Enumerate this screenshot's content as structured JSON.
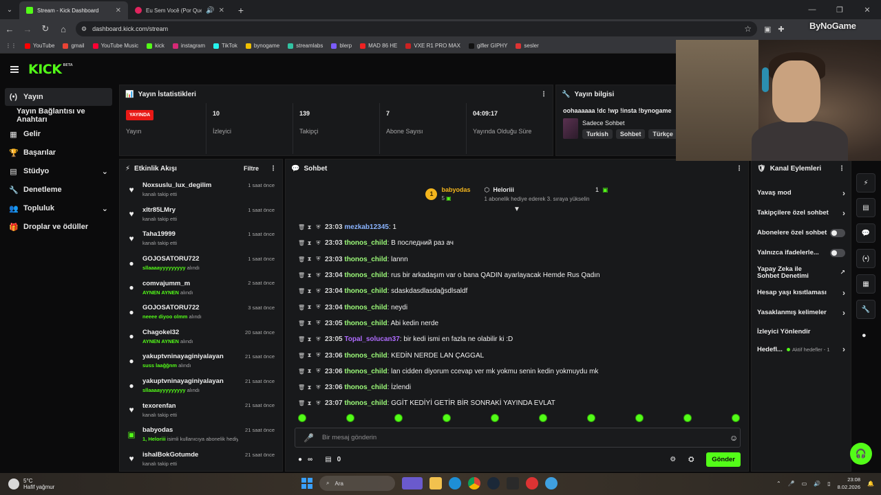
{
  "browser": {
    "tabs": [
      {
        "title": "Stream - Kick Dashboard",
        "favicon_color": "#53fc18",
        "active": true
      },
      {
        "title": "Eu Sem Você (Por Que Te V...",
        "favicon_color": "#e0245e",
        "active": false
      }
    ],
    "url": "dashboard.kick.com/stream",
    "bookmarks": [
      {
        "label": "YouTube",
        "color": "#ff0000"
      },
      {
        "label": "gmail",
        "color": "#ea4335"
      },
      {
        "label": "YouTube Music",
        "color": "#ff0033"
      },
      {
        "label": "kick",
        "color": "#53fc18"
      },
      {
        "label": "instagram",
        "color": "#d62976"
      },
      {
        "label": "TikTok",
        "color": "#25f4ee"
      },
      {
        "label": "bynogame",
        "color": "#f0c000"
      },
      {
        "label": "streamlabs",
        "color": "#31c3a2"
      },
      {
        "label": "blerp",
        "color": "#7b5cff"
      },
      {
        "label": "MAD 86 HE",
        "color": "#e22"
      },
      {
        "label": "VXE R1 PRO MAX",
        "color": "#c22"
      },
      {
        "label": "gifler GIPHY",
        "color": "#111"
      },
      {
        "label": "sesler",
        "color": "#d33"
      }
    ]
  },
  "watermark": "ByNoGame",
  "kick": {
    "logo": "KICK",
    "logo_badge": "BETA",
    "nav": [
      {
        "label": "Yayın",
        "icon": "broadcast-icon",
        "glyph": "(•)",
        "active": true
      },
      {
        "label": "Yayın Bağlantısı ve Anahtarı",
        "icon": "",
        "glyph": "",
        "sub": true
      },
      {
        "label": "Gelir",
        "icon": "revenue-icon",
        "glyph": "▦"
      },
      {
        "label": "Başarılar",
        "icon": "trophy-icon",
        "glyph": "🏆"
      },
      {
        "label": "Stüdyo",
        "icon": "studio-icon",
        "glyph": "▤",
        "chevron": true
      },
      {
        "label": "Denetleme",
        "icon": "wrench-icon",
        "glyph": "🔧"
      },
      {
        "label": "Topluluk",
        "icon": "community-icon",
        "glyph": "👥",
        "chevron": true
      },
      {
        "label": "Droplar ve ödüller",
        "icon": "drops-icon",
        "glyph": "🎁"
      }
    ],
    "stats_panel": {
      "title": "Yayın İstatistikleri",
      "live_badge": "YAYINDA",
      "items": [
        {
          "value": "",
          "label": "Yayın"
        },
        {
          "value": "10",
          "label": "İzleyici"
        },
        {
          "value": "139",
          "label": "Takipçi"
        },
        {
          "value": "7",
          "label": "Abone Sayısı"
        },
        {
          "value": "04:09:17",
          "label": "Yayında Olduğu Süre"
        }
      ]
    },
    "info_panel": {
      "title": "Yayın bilgisi",
      "stream_title": "oohaaaaaa !dc !wp !insta !bynogame",
      "category": "Sadece Sohbet",
      "tags": [
        "Turkish",
        "Sohbet",
        "Türkçe"
      ]
    },
    "activity": {
      "title": "Etkinlik Akışı",
      "filter": "Filtre",
      "items": [
        {
          "icon": "heart-icon",
          "glyph": "♥",
          "name": "Noxsuslu_lux_degilim",
          "sub": "kanalı takip etti",
          "hl": "",
          "time": "1 saat önce"
        },
        {
          "icon": "heart-icon",
          "glyph": "♥",
          "name": "xltr85LMry",
          "sub": "kanalı takip etti",
          "hl": "",
          "time": "1 saat önce"
        },
        {
          "icon": "heart-icon",
          "glyph": "♥",
          "name": "Taha19999",
          "sub": "kanalı takip etti",
          "hl": "",
          "time": "1 saat önce"
        },
        {
          "icon": "points-icon",
          "glyph": "●",
          "name": "GOJOSATORU722",
          "sub": " alındı",
          "hl": "sllaaaayyyyyyyyy",
          "time": "1 saat önce"
        },
        {
          "icon": "points-icon",
          "glyph": "●",
          "name": "comvajumm_m",
          "sub": " alındı",
          "hl": "AYNEN AYNEN",
          "time": "2 saat önce"
        },
        {
          "icon": "points-icon",
          "glyph": "●",
          "name": "GOJOSATORU722",
          "sub": " alındı",
          "hl": "neeee diyoo olmm",
          "time": "3 saat önce"
        },
        {
          "icon": "points-icon",
          "glyph": "●",
          "name": "Chagokel32",
          "sub": " alındı",
          "hl": "AYNEN AYNEN",
          "time": "20 saat önce"
        },
        {
          "icon": "points-icon",
          "glyph": "●",
          "name": "yakuptvninayaginiyalayan",
          "sub": " alındı",
          "hl": "suss laağğnm",
          "time": "21 saat önce"
        },
        {
          "icon": "points-icon",
          "glyph": "●",
          "name": "yakuptvninayaginiyalayan",
          "sub": " alındı",
          "hl": "sllaaaayyyyyyyyy",
          "time": "21 saat önce"
        },
        {
          "icon": "heart-icon",
          "glyph": "♥",
          "name": "texorenfan",
          "sub": "kanalı takip etti",
          "hl": "",
          "time": "21 saat önce"
        },
        {
          "icon": "gift-icon",
          "glyph": "▣",
          "name": "babyodas",
          "sub": " isimli kullanıcıya abonelik hediye etti.",
          "hl": "1, Heloriii",
          "time": "21 saat önce"
        },
        {
          "icon": "heart-icon",
          "glyph": "♥",
          "name": "ishalBokGotumde",
          "sub": "kanalı takip etti",
          "hl": "",
          "time": "21 saat önce"
        }
      ]
    },
    "chat": {
      "title": "Sohbet",
      "pinned": {
        "rank": "1",
        "gifter": "babyodas",
        "gifter_count": "5",
        "recipient": "Heloriii",
        "recipient_count": "1",
        "note": "1 abonelik hediye ederek 3. sıraya yükselin"
      },
      "messages": [
        {
          "time": "23:03",
          "user": "mezkab12345",
          "color": "#8ab4ff",
          "text": "1"
        },
        {
          "time": "23:03",
          "user": "thonos_child",
          "color": "#9dfc7a",
          "text": "В последний раз ач"
        },
        {
          "time": "23:03",
          "user": "thonos_child",
          "color": "#9dfc7a",
          "text": "lannn"
        },
        {
          "time": "23:04",
          "user": "thonos_child",
          "color": "#9dfc7a",
          "text": "rus bir arkadaşım var o bana QADIN ayarlayacak Hemde Rus Qadın"
        },
        {
          "time": "23:04",
          "user": "thonos_child",
          "color": "#9dfc7a",
          "text": "sdaskdasdlasdağsdlsaldf"
        },
        {
          "time": "23:04",
          "user": "thonos_child",
          "color": "#9dfc7a",
          "text": "neydi"
        },
        {
          "time": "23:05",
          "user": "thonos_child",
          "color": "#9dfc7a",
          "text": "Abi kedin nerde"
        },
        {
          "time": "23:05",
          "user": "Topal_solucan37",
          "color": "#b06cff",
          "text": "bir kedi ismi en fazla ne olabilir ki :D"
        },
        {
          "time": "23:06",
          "user": "thonos_child",
          "color": "#9dfc7a",
          "text": "KEDİN NERDE LAN ÇAGGAL"
        },
        {
          "time": "23:06",
          "user": "thonos_child",
          "color": "#9dfc7a",
          "text": "lan cidden diyorum ccevap ver mk yokmu senin kedin yokmuydu mk"
        },
        {
          "time": "23:06",
          "user": "thonos_child",
          "color": "#9dfc7a",
          "text": "İzlendi"
        },
        {
          "time": "23:07",
          "user": "thonos_child",
          "color": "#9dfc7a",
          "text": "GGİT KEDİYİ GETİR BİR SONRAKİ YAYINDA EVLAT"
        }
      ],
      "placeholder": "Bir mesaj gönderin",
      "points": "∞",
      "count": "0",
      "send": "Gönder"
    },
    "channel_actions": {
      "title": "Kanal Eylemleri",
      "items": [
        {
          "label": "Yavaş mod",
          "control": "chevron"
        },
        {
          "label": "Takipçilere özel sohbet",
          "control": "chevron"
        },
        {
          "label": "Abonelere özel sohbet",
          "control": "toggle"
        },
        {
          "label": "Yalnızca ifadelerle...",
          "control": "toggle"
        },
        {
          "label": "Yapay Zeka ile Sohbet Denetimi",
          "control": "external"
        },
        {
          "label": "Hesap yaşı kısıtlaması",
          "control": "chevron"
        },
        {
          "label": "Yasaklanmış kelimeler",
          "control": "chevron"
        },
        {
          "label": "İzleyici Yönlendir",
          "control": "none"
        },
        {
          "label": "Hedefl...",
          "control": "goal",
          "sub": "Aktif hedefler - 1"
        }
      ]
    },
    "accent": "#53fc18"
  },
  "taskbar": {
    "temp": "5°C",
    "weather": "Hafif yağmur",
    "search": "Ara",
    "time": "23:08",
    "date": "8.02.2026"
  }
}
